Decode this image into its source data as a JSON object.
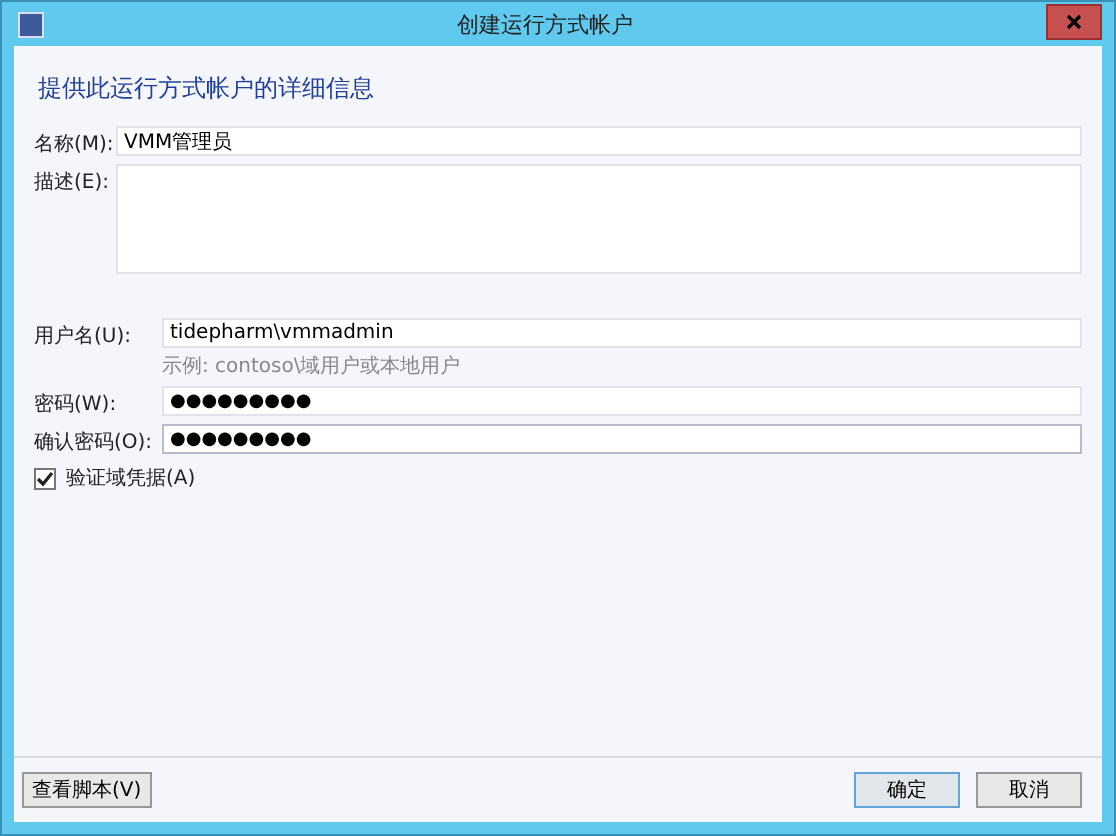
{
  "window": {
    "title": "创建运行方式帐户"
  },
  "heading": "提供此运行方式帐户的详细信息",
  "fields": [
    {
      "kind": "text",
      "label": "名称(M):",
      "value": "VMM管理员",
      "focused": false
    },
    {
      "kind": "multiline",
      "label": "描述(E):",
      "focused": false
    },
    {
      "kind": "text",
      "label": "用户名(U):",
      "value": "tidepharm\\vmmadmin",
      "hint": "示例: contoso\\域用户或本地用户",
      "focused": false
    },
    {
      "kind": "password",
      "label": "密码(W):",
      "value": "●●●●●●●●●",
      "focused": false
    },
    {
      "kind": "password",
      "label": "确认密码(O):",
      "value": "●●●●●●●●●",
      "focused": true
    }
  ],
  "checkbox": {
    "label": "验证域凭据(A)",
    "checked": true
  },
  "buttons": [
    {
      "label": "查看脚本(V)",
      "default": false
    },
    {
      "label": "确定",
      "default": true
    },
    {
      "label": "取消",
      "default": false
    }
  ]
}
